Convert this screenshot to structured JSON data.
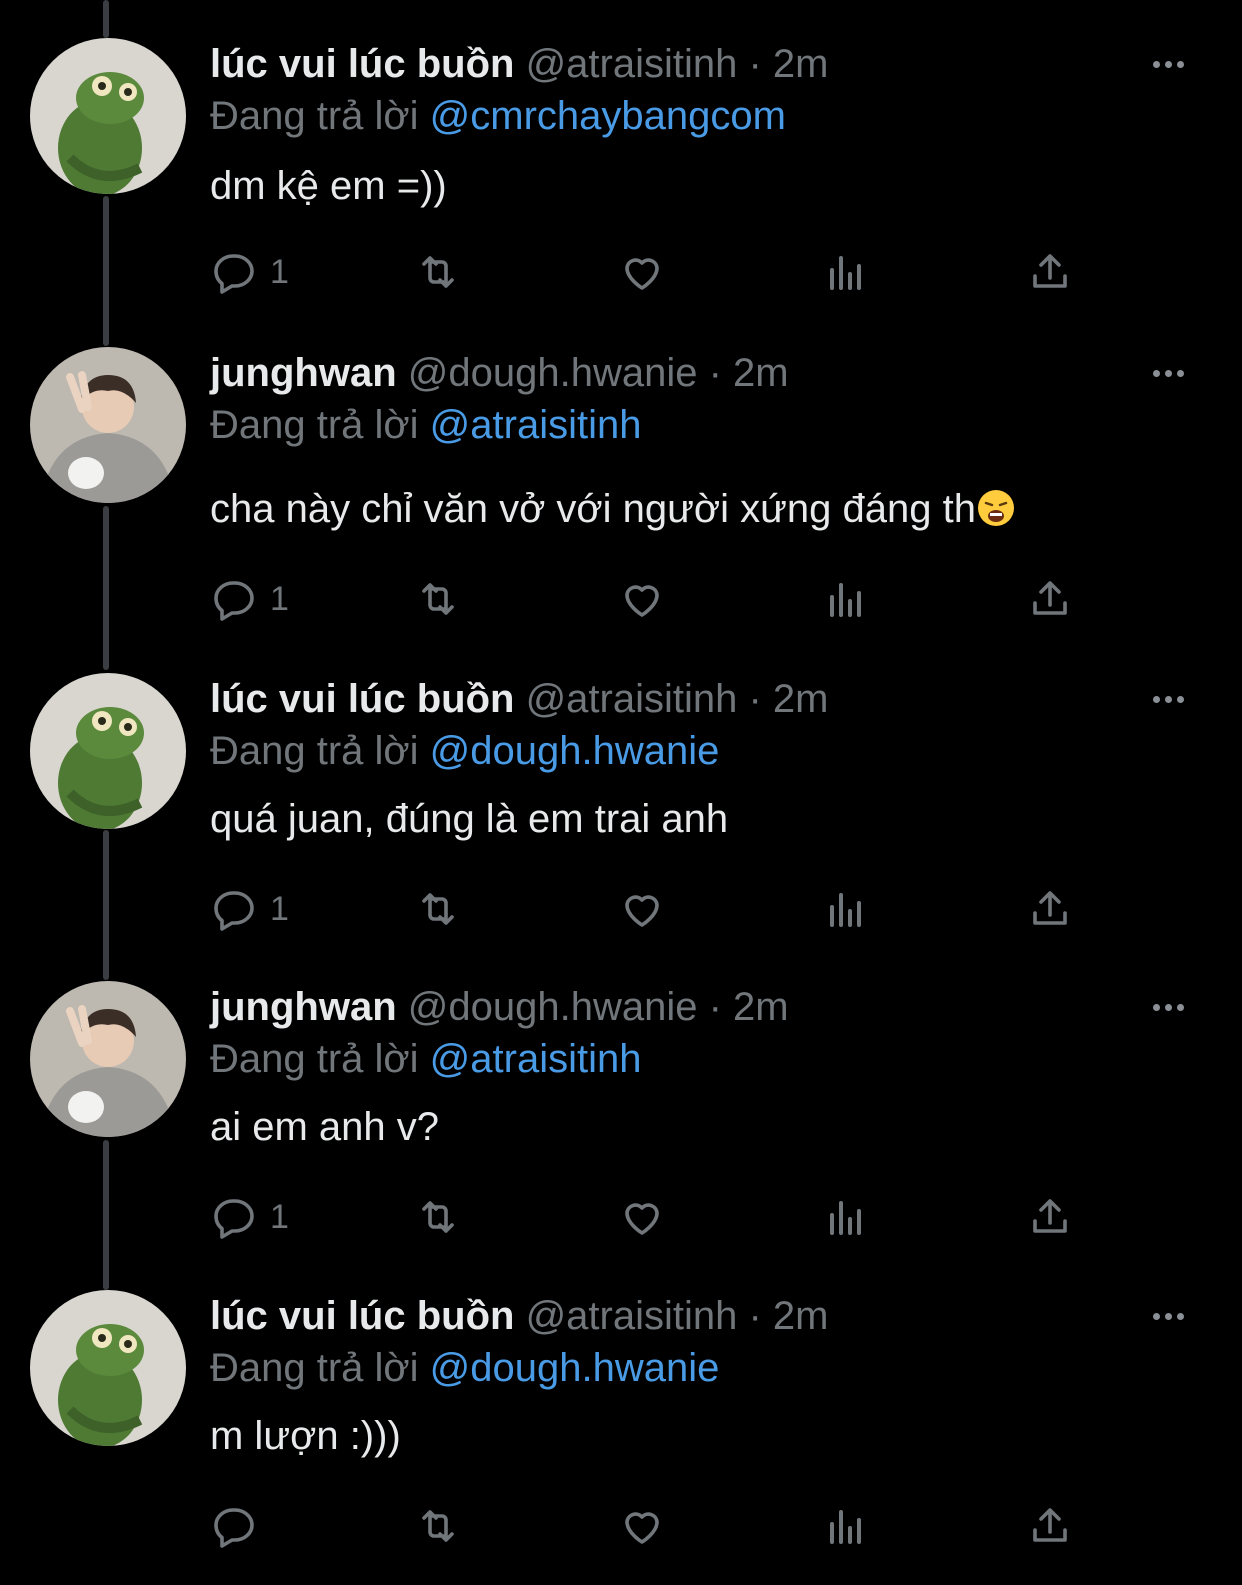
{
  "tweets": [
    {
      "name": "lúc vui lúc buồn",
      "handle": "@atraisitinh",
      "time": "· 2m",
      "reply_prefix": "Đang trả lời",
      "reply_to": "@cmrchaybangcom",
      "text": "dm kệ em =))",
      "reply_count": "1",
      "avatar": "kermit-plush-avatar"
    },
    {
      "name": "junghwan",
      "handle": "@dough.hwanie",
      "time": "· 2m",
      "reply_prefix": "Đang trả lời",
      "reply_to": "@atraisitinh",
      "text": "cha này chỉ văn vở với người xứng đáng th",
      "emoji": "weary-face-emoji",
      "reply_count": "1",
      "avatar": "person-peace-sign-avatar"
    },
    {
      "name": "lúc vui lúc buồn",
      "handle": "@atraisitinh",
      "time": "· 2m",
      "reply_prefix": "Đang trả lời",
      "reply_to": "@dough.hwanie",
      "text": "quá juan, đúng là em trai anh",
      "reply_count": "1",
      "avatar": "kermit-plush-avatar"
    },
    {
      "name": "junghwan",
      "handle": "@dough.hwanie",
      "time": "· 2m",
      "reply_prefix": "Đang trả lời",
      "reply_to": "@atraisitinh",
      "text": "ai em anh v?",
      "reply_count": "1",
      "avatar": "person-peace-sign-avatar"
    },
    {
      "name": "lúc vui lúc buồn",
      "handle": "@atraisitinh",
      "time": "· 2m",
      "reply_prefix": "Đang trả lời",
      "reply_to": "@dough.hwanie",
      "text": "m lượn :)))",
      "reply_count": "",
      "avatar": "kermit-plush-avatar"
    }
  ],
  "colors": {
    "background": "#000000",
    "name": "#e7e9ea",
    "muted": "#71767b",
    "mention": "#4a9be6",
    "thread_line": "#3a3d41"
  },
  "icons": [
    "reply-icon",
    "retweet-icon",
    "like-icon",
    "analytics-icon",
    "share-icon",
    "more-icon"
  ]
}
